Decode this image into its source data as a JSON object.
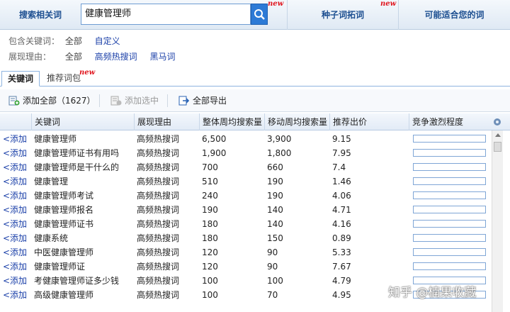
{
  "search": {
    "label": "搜索相关词",
    "value": "健康管理师",
    "badge": "new"
  },
  "top_tabs": [
    {
      "label": "种子词拓词",
      "badge": "new"
    },
    {
      "label": "可能适合您的词"
    }
  ],
  "filters": {
    "include": {
      "label": "包含关键词：",
      "options": [
        "全部",
        "自定义"
      ]
    },
    "reason": {
      "label": "展现理由：",
      "options": [
        "全部",
        "高频热搜词",
        "黑马词"
      ]
    }
  },
  "sub_tabs": {
    "active": "关键词",
    "inactive": "推荐词包",
    "badge": "new"
  },
  "toolbar": {
    "add_all": "添加全部（1627）",
    "add_selected": "添加选中",
    "export_all": "全部导出"
  },
  "table": {
    "add_label": "<添加",
    "headers": [
      "关键词",
      "展现理由",
      "整体周均搜索量",
      "移动周均搜索量",
      "推荐出价",
      "竞争激烈程度"
    ],
    "rows": [
      {
        "keyword": "健康管理师",
        "reason": "高频热搜词",
        "overall": "6,500",
        "mobile": "3,900",
        "bid": "9.15",
        "competition": 0
      },
      {
        "keyword": "健康管理师证书有用吗",
        "reason": "高频热搜词",
        "overall": "1,900",
        "mobile": "1,800",
        "bid": "7.95",
        "competition": 0
      },
      {
        "keyword": "健康管理师是干什么的",
        "reason": "高频热搜词",
        "overall": "700",
        "mobile": "660",
        "bid": "7.4",
        "competition": 0
      },
      {
        "keyword": "健康管理",
        "reason": "高频热搜词",
        "overall": "510",
        "mobile": "190",
        "bid": "1.46",
        "competition": 0
      },
      {
        "keyword": "健康管理师考试",
        "reason": "高频热搜词",
        "overall": "240",
        "mobile": "190",
        "bid": "4.06",
        "competition": 0
      },
      {
        "keyword": "健康管理师报名",
        "reason": "高频热搜词",
        "overall": "190",
        "mobile": "140",
        "bid": "4.71",
        "competition": 0
      },
      {
        "keyword": "健康管理师证书",
        "reason": "高频热搜词",
        "overall": "180",
        "mobile": "140",
        "bid": "4.16",
        "competition": 0
      },
      {
        "keyword": "健康系统",
        "reason": "高频热搜词",
        "overall": "180",
        "mobile": "150",
        "bid": "0.89",
        "competition": 0
      },
      {
        "keyword": "中医健康管理师",
        "reason": "高频热搜词",
        "overall": "120",
        "mobile": "90",
        "bid": "5.33",
        "competition": 0
      },
      {
        "keyword": "健康管理师证",
        "reason": "高频热搜词",
        "overall": "120",
        "mobile": "90",
        "bid": "7.67",
        "competition": 0
      },
      {
        "keyword": "考健康管理师证多少钱",
        "reason": "高频热搜词",
        "overall": "100",
        "mobile": "100",
        "bid": "4.79",
        "competition": 0
      },
      {
        "keyword": "高级健康管理师",
        "reason": "高频热搜词",
        "overall": "100",
        "mobile": "70",
        "bid": "4.95",
        "competition": 0
      }
    ]
  },
  "watermark": "知乎 @楠果收藏",
  "colors": {
    "link": "#1a3fa8",
    "header_text": "#1d4f91",
    "badge": "#e0141c",
    "search_button": "#2c7ad6"
  }
}
